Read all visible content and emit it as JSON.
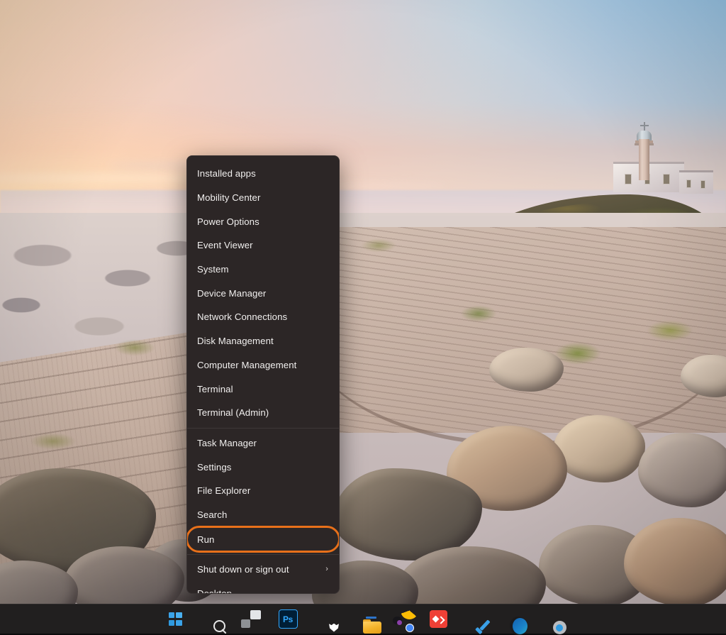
{
  "desktop": {
    "wallpaper_description": "Sunset beach with wooden boardwalk, dunes, boulders and a lighthouse on a headland",
    "accent_color": "#2f9ae0",
    "highlight_color": "#e8701a",
    "menu_background": "#2c2626",
    "taskbar_background": "#211f1f"
  },
  "winx_menu": {
    "name": "Quick Link menu",
    "groups": [
      {
        "items": [
          {
            "label": "Installed apps",
            "has_submenu": false
          },
          {
            "label": "Mobility Center",
            "has_submenu": false
          },
          {
            "label": "Power Options",
            "has_submenu": false
          },
          {
            "label": "Event Viewer",
            "has_submenu": false
          },
          {
            "label": "System",
            "has_submenu": false
          },
          {
            "label": "Device Manager",
            "has_submenu": false
          },
          {
            "label": "Network Connections",
            "has_submenu": false
          },
          {
            "label": "Disk Management",
            "has_submenu": false
          },
          {
            "label": "Computer Management",
            "has_submenu": false
          },
          {
            "label": "Terminal",
            "has_submenu": false
          },
          {
            "label": "Terminal (Admin)",
            "has_submenu": false
          }
        ]
      },
      {
        "items": [
          {
            "label": "Task Manager",
            "has_submenu": false
          },
          {
            "label": "Settings",
            "has_submenu": false
          },
          {
            "label": "File Explorer",
            "has_submenu": false
          },
          {
            "label": "Search",
            "has_submenu": false
          },
          {
            "label": "Run",
            "has_submenu": false,
            "highlighted": true
          }
        ]
      },
      {
        "items": [
          {
            "label": "Shut down or sign out",
            "has_submenu": true,
            "chevron": "›"
          },
          {
            "label": "Desktop",
            "has_submenu": false
          }
        ]
      }
    ]
  },
  "taskbar": {
    "items": [
      {
        "name": "start-button",
        "label": "Start",
        "icon": "windows-logo-icon"
      },
      {
        "name": "search-button",
        "label": "Search",
        "icon": "search-icon"
      },
      {
        "name": "task-view-button",
        "label": "Task View",
        "icon": "task-view-icon"
      },
      {
        "name": "photoshop-button",
        "label": "Ps",
        "icon": "photoshop-icon"
      },
      {
        "name": "brave-button",
        "label": "Brave",
        "icon": "brave-lion-icon"
      },
      {
        "name": "file-explorer-button",
        "label": "File Explorer",
        "icon": "folder-icon"
      },
      {
        "name": "chrome-button",
        "label": "Google Chrome",
        "icon": "chrome-icon"
      },
      {
        "name": "red-app-button",
        "label": "App",
        "icon": "red-diamond-icon"
      },
      {
        "name": "todoist-button",
        "label": "Todoist",
        "icon": "blue-check-icon"
      },
      {
        "name": "edge-button",
        "label": "Microsoft Edge",
        "icon": "edge-icon"
      },
      {
        "name": "settings-button",
        "label": "Settings",
        "icon": "gear-icon"
      }
    ]
  }
}
